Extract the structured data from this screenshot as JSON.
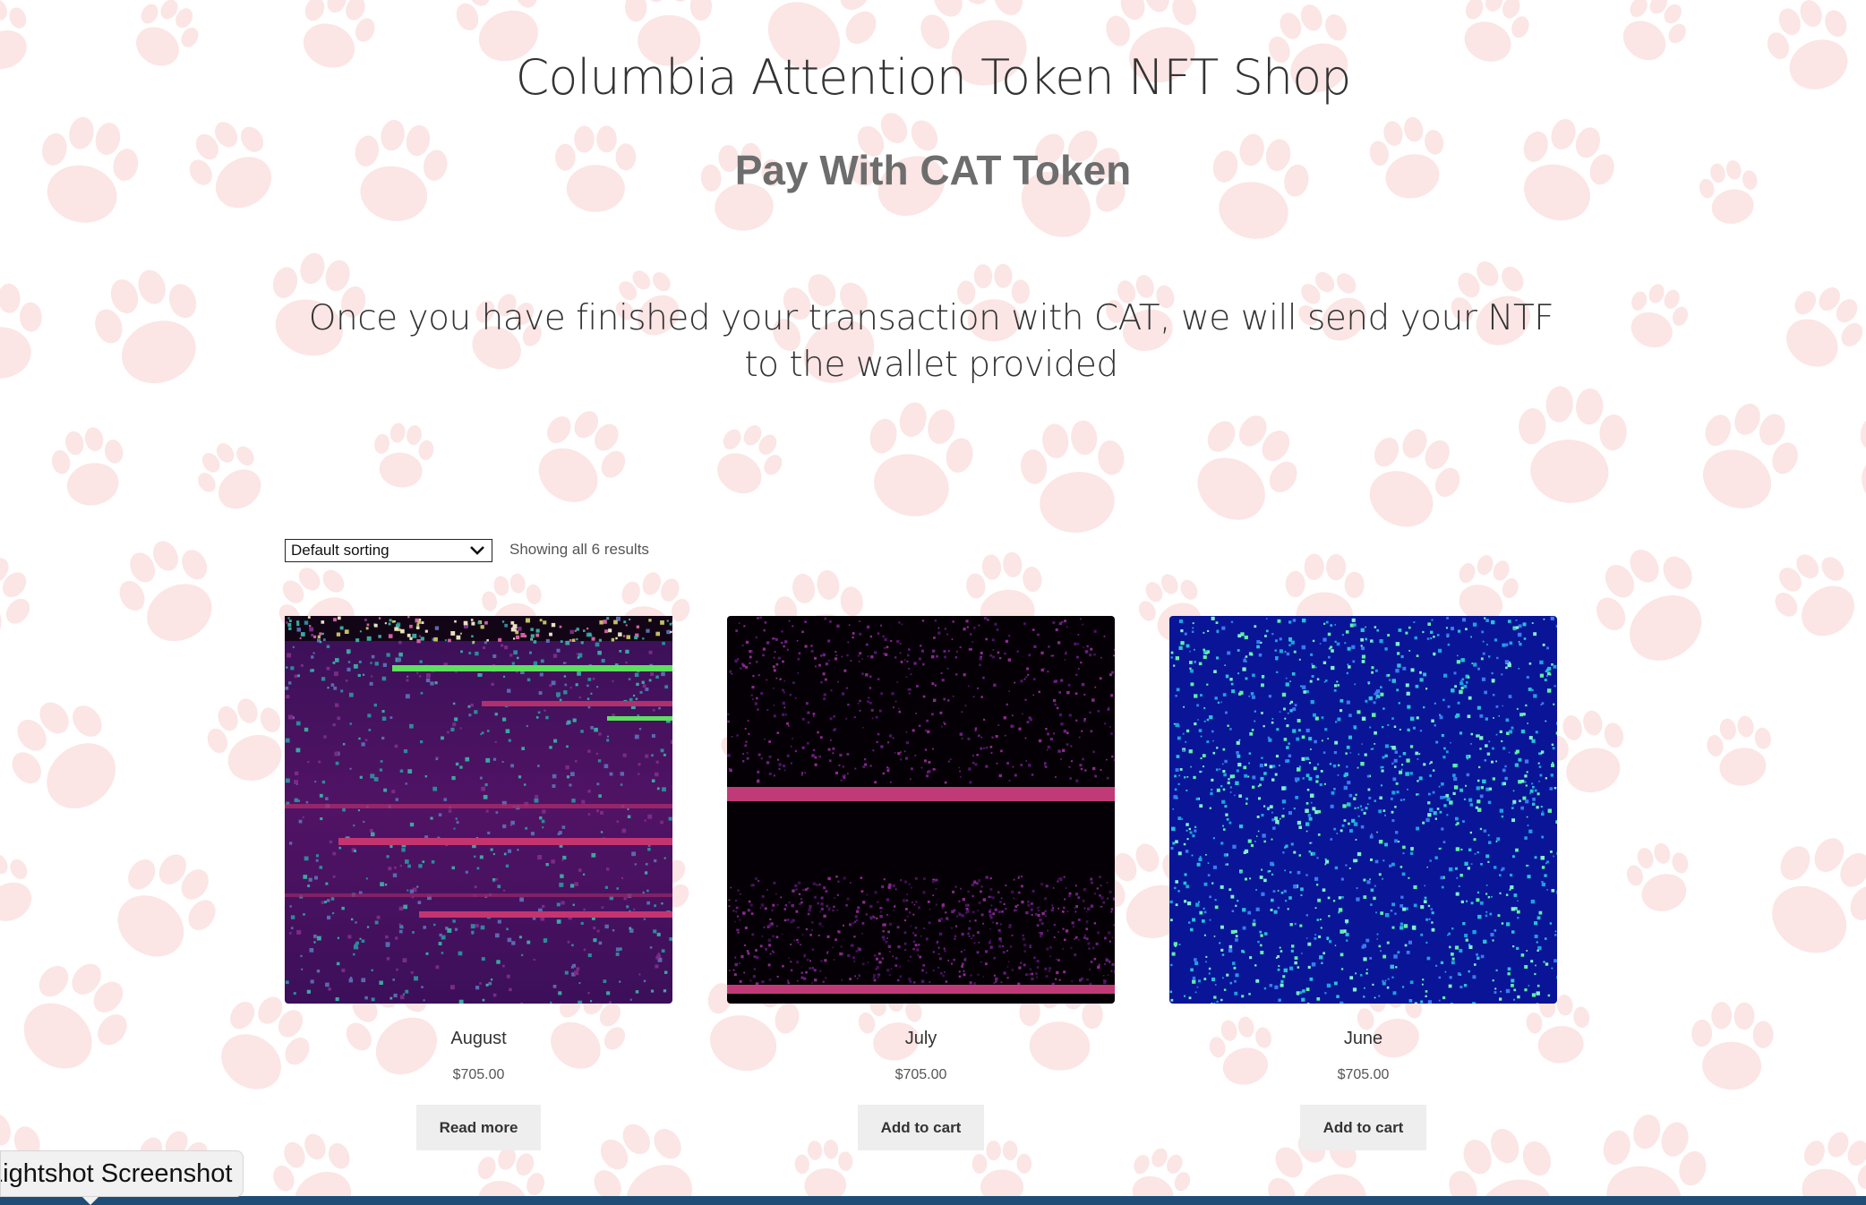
{
  "header": {
    "site_title": "Columbia Attention Token NFT Shop",
    "subtitle": "Pay With CAT Token",
    "notice": "Once you have finished your transaction with CAT, we will send your NTF to the wallet provided"
  },
  "shop": {
    "sort_selected": "Default sorting",
    "result_count": "Showing all 6 results",
    "products": [
      {
        "name": "August",
        "price": "$705.00",
        "button": "Read more",
        "image": "purple glitch art"
      },
      {
        "name": "July",
        "price": "$705.00",
        "button": "Add to cart",
        "image": "black glitch art with pink bands"
      },
      {
        "name": "June",
        "price": "$705.00",
        "button": "Add to cart",
        "image": "blue cellular noise art"
      }
    ]
  },
  "overlay": {
    "tooltip_text": "Lightshot Screenshot"
  },
  "colors": {
    "paw": "#fbe5e5",
    "subtitle": "#6d6d6d",
    "button_bg": "#eeeeee",
    "taskbar": "#1f4d77"
  },
  "icons": {
    "background": "paw-print-icon",
    "select_arrow": "chevron-down-icon"
  }
}
